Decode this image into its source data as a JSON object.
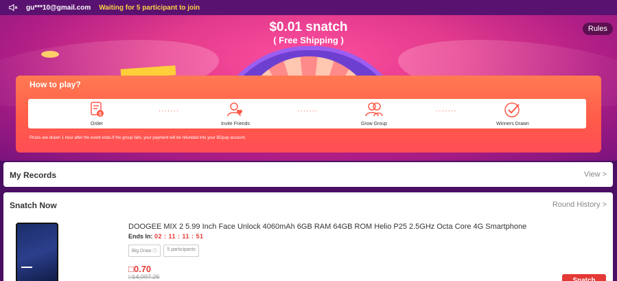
{
  "topbar": {
    "email": "gu***10@gmail.com",
    "status": "Waiting for 5 participant to join"
  },
  "banner": {
    "title": "$0.01 snatch",
    "subtitle": "( Free Shipping )",
    "rules_label": "Rules"
  },
  "how_to_play": {
    "title": "How to play?",
    "steps": [
      {
        "label": "Order",
        "icon": "order-icon"
      },
      {
        "label": "Invite Friends",
        "icon": "invite-friends-icon"
      },
      {
        "label": "Grow Group",
        "icon": "grow-group-icon"
      },
      {
        "label": "Winners Drawn",
        "icon": "winners-drawn-icon"
      }
    ],
    "connector": "·······",
    "note": "Prizes are drawn 1 hour after the event ends.If the group fails, your payment will be refunded into your BGpay account."
  },
  "records": {
    "title": "My Records",
    "view_label": "View >"
  },
  "snatch": {
    "title": "Snatch Now",
    "round_history_label": "Round History >",
    "product": {
      "name": "DOOGEE MIX 2 5.99 Inch Face Unlock 4060mAh 6GB RAM 64GB ROM Helio P25 2.5GHz Octa Core 4G Smartphone",
      "ends_label": "Ends In:",
      "ends_time": "02 : 11 : 11 : 51",
      "tags": [
        "Big Draw",
        "5 participants"
      ],
      "price": "0.70",
      "original_price": "14,097.26",
      "button_label": "Snatch"
    }
  },
  "colors": {
    "accent": "#ff5a4a",
    "price": "#e53935",
    "status": "#ffd24a"
  }
}
